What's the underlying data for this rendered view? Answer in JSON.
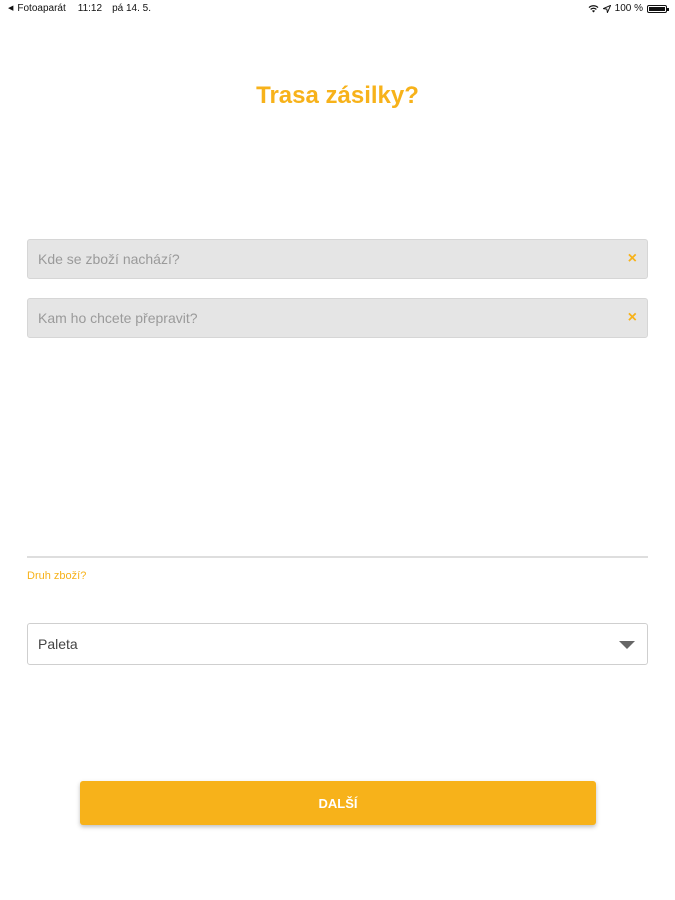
{
  "status_bar": {
    "back_app": "Fotoaparát",
    "time": "11:12",
    "date": "pá 14. 5.",
    "battery": "100 %"
  },
  "page": {
    "title": "Trasa zásilky?"
  },
  "route": {
    "from_placeholder": "Kde se zboží nachází?",
    "from_value": "",
    "to_placeholder": "Kam ho chcete přepravit?",
    "to_value": "",
    "clear_glyph": "×"
  },
  "goods": {
    "label": "Druh zboží?",
    "selected": "Paleta"
  },
  "actions": {
    "next_label": "DALŠÍ"
  },
  "colors": {
    "accent": "#f7b21a",
    "field_bg": "#e5e5e5"
  }
}
